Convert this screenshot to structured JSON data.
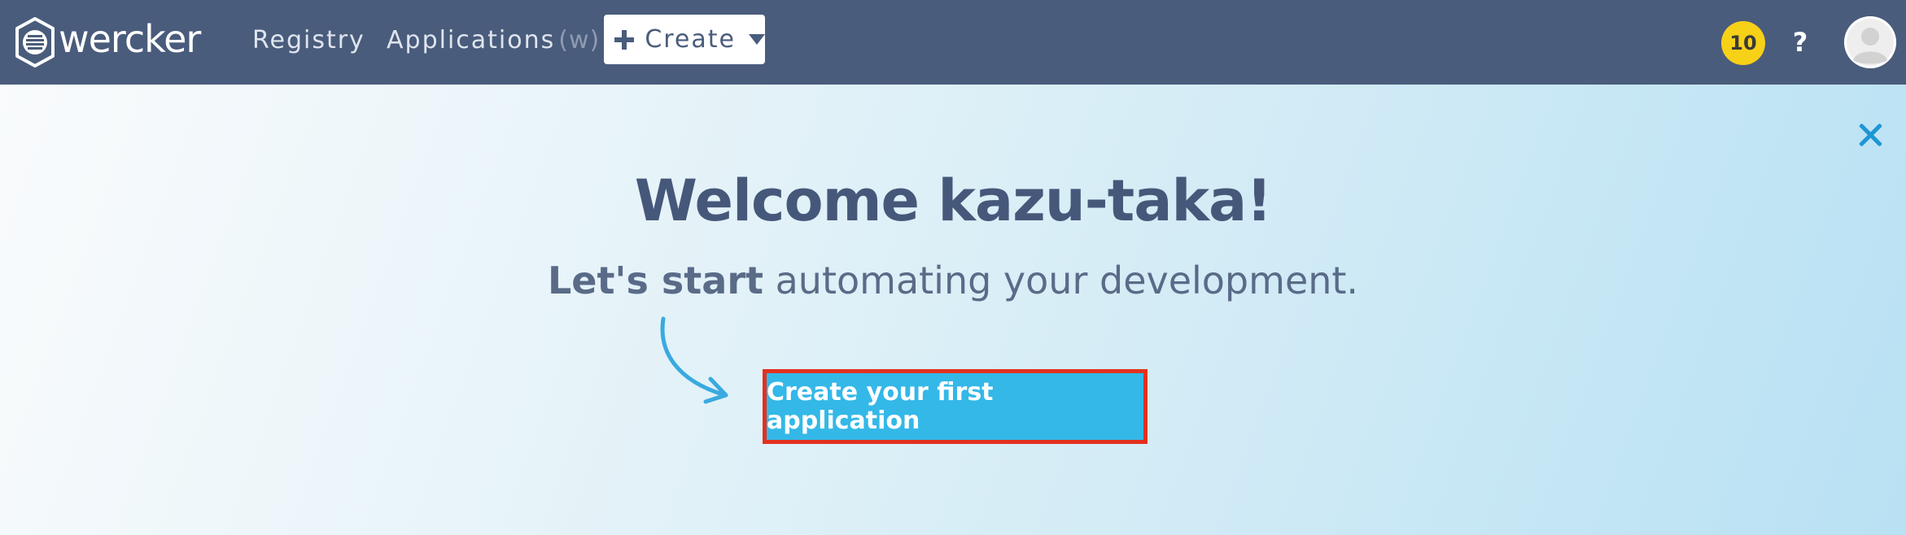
{
  "topbar": {
    "logo_text": "wercker",
    "logo_icon": "wercker-logo-icon",
    "nav": {
      "registry": "Registry",
      "applications": "Applications",
      "applications_shortcut": "(w)"
    },
    "create": {
      "label": "Create",
      "icon": "plus-icon",
      "caret": "caret-down-icon"
    },
    "notifications_count": "10",
    "help_label": "?",
    "avatar_icon": "user-avatar-icon"
  },
  "banner": {
    "close_icon": "close-icon",
    "title": "Welcome kazu-taka!",
    "subtitle_strong": "Let's start",
    "subtitle_rest": " automating your development.",
    "arrow_icon": "curved-arrow-icon",
    "cta_label": "Create your first application"
  },
  "colors": {
    "topbar": "#4a5c7c",
    "badge": "#f7d117",
    "cta": "#33b8e8",
    "cta_highlight_border": "#e2311f",
    "close": "#1e96d4",
    "arrow": "#3aa9e0"
  }
}
